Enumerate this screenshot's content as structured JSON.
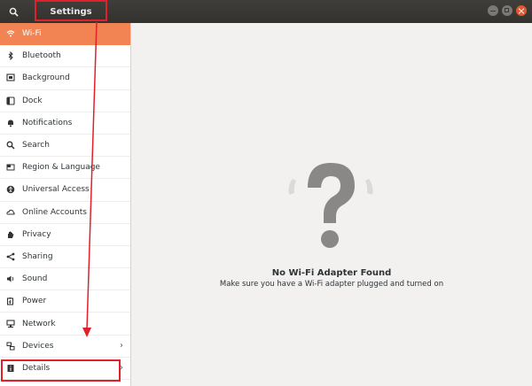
{
  "window": {
    "title": "Settings"
  },
  "sidebar": {
    "items": [
      {
        "label": "Wi-Fi",
        "icon": "wifi-icon"
      },
      {
        "label": "Bluetooth",
        "icon": "bluetooth-icon"
      },
      {
        "label": "Background",
        "icon": "background-icon"
      },
      {
        "label": "Dock",
        "icon": "dock-icon"
      },
      {
        "label": "Notifications",
        "icon": "bell-icon"
      },
      {
        "label": "Search",
        "icon": "search-icon"
      },
      {
        "label": "Region & Language",
        "icon": "flag-icon"
      },
      {
        "label": "Universal Access",
        "icon": "accessibility-icon"
      },
      {
        "label": "Online Accounts",
        "icon": "cloud-icon"
      },
      {
        "label": "Privacy",
        "icon": "hand-icon"
      },
      {
        "label": "Sharing",
        "icon": "share-icon"
      },
      {
        "label": "Sound",
        "icon": "speaker-icon"
      },
      {
        "label": "Power",
        "icon": "battery-icon"
      },
      {
        "label": "Network",
        "icon": "network-icon"
      },
      {
        "label": "Devices",
        "icon": "devices-icon"
      },
      {
        "label": "Details",
        "icon": "info-icon"
      }
    ],
    "active": "Wi-Fi",
    "accent": "#f28454"
  },
  "main": {
    "empty_title": "No Wi-Fi Adapter Found",
    "empty_subtitle": "Make sure you have a Wi-Fi adapter plugged and turned on"
  },
  "annotation": {
    "color": "#e0202a"
  }
}
